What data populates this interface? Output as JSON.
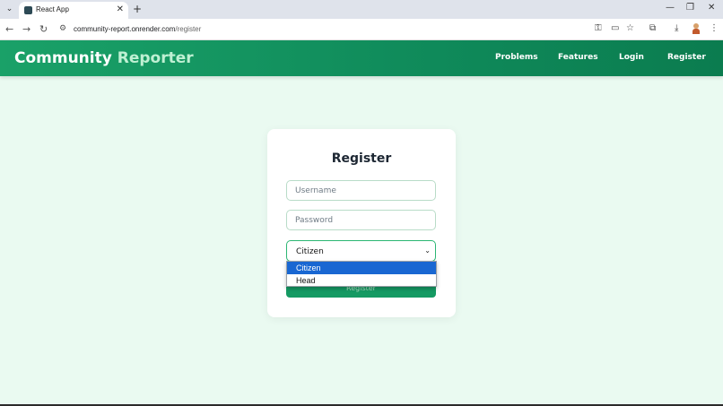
{
  "browser": {
    "tab_list_glyph": "⌄",
    "tab_title": "React App",
    "tab_close_glyph": "✕",
    "new_tab_glyph": "+",
    "minimize_glyph": "—",
    "restore_glyph": "❐",
    "close_glyph": "✕",
    "back_glyph": "←",
    "forward_glyph": "→",
    "reload_glyph": "↻",
    "site_info_glyph": "⚙",
    "url_domain": "community-report.onrender.com",
    "url_path": "/register",
    "password_icon_glyph": "⚿",
    "cast_icon_glyph": "▭",
    "star_icon_glyph": "☆",
    "extensions_icon_glyph": "⧉",
    "download_icon_glyph": "⤓",
    "menu_icon_glyph": "⋮"
  },
  "header": {
    "brand_main": "Community ",
    "brand_accent": "Reporter",
    "nav": [
      "Problems",
      "Features",
      "Login",
      "Register"
    ]
  },
  "form": {
    "title": "Register",
    "username_placeholder": "Username",
    "password_placeholder": "Password",
    "role_selected": "Citizen",
    "caret_glyph": "⌄",
    "submit_label": "Register"
  },
  "dropdown": {
    "options": [
      "Citizen",
      "Head"
    ],
    "selected_index": 0
  },
  "colors": {
    "header_start": "#1aa168",
    "header_end": "#0b7c4f",
    "page_background": "#eafaf1",
    "button": "#159a63",
    "dropdown_highlight": "#1967d2"
  }
}
